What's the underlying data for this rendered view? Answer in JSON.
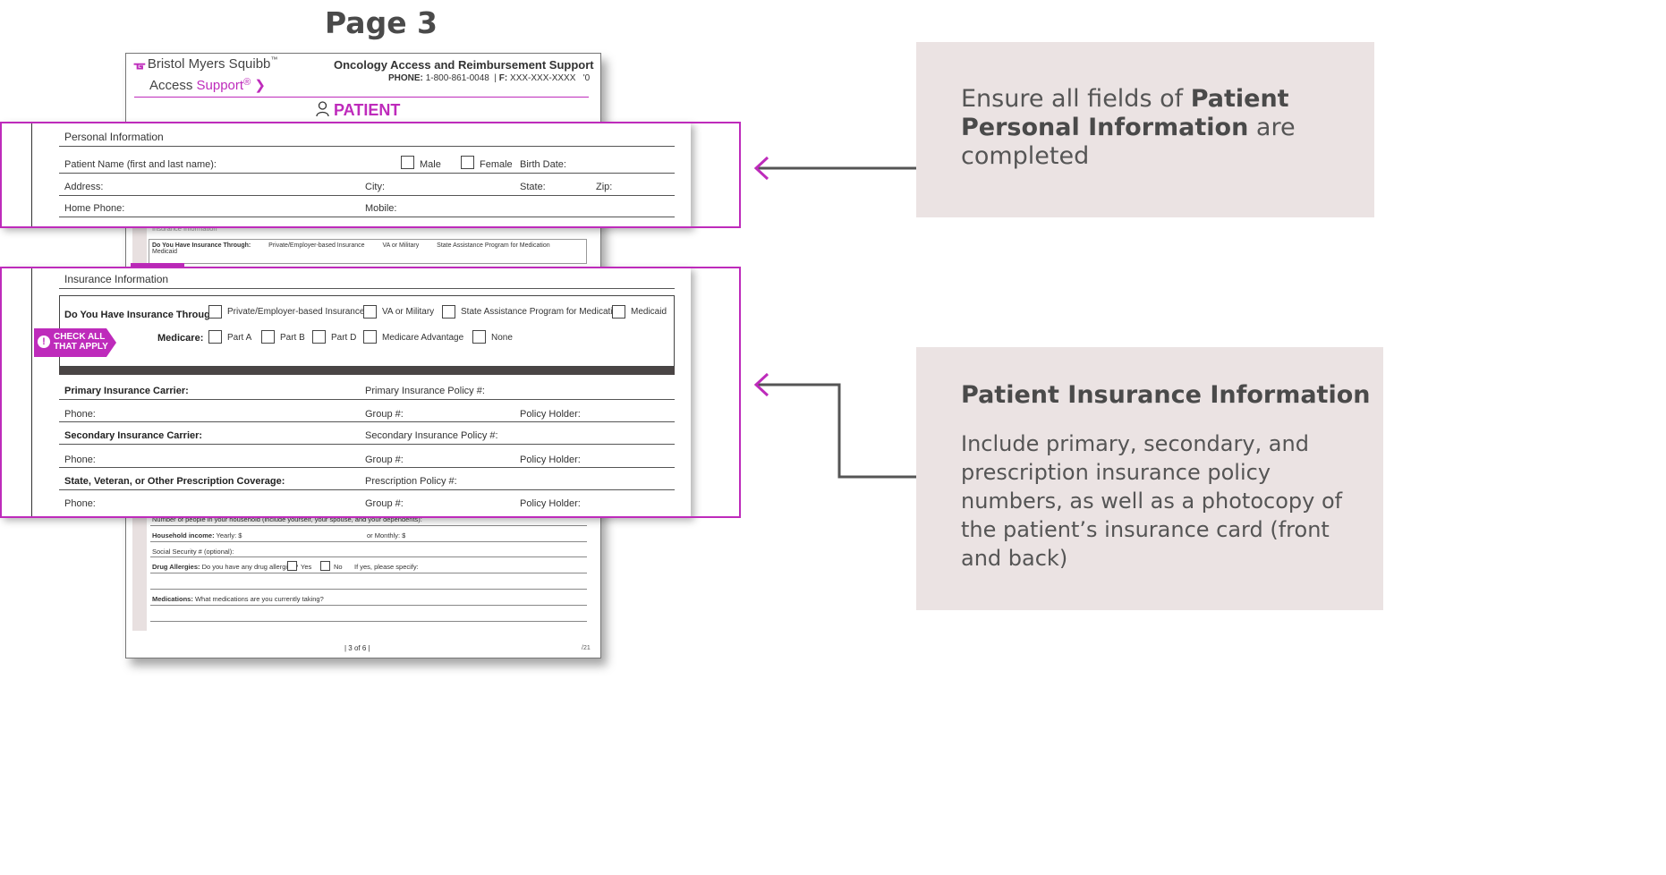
{
  "page_label": "Page 3",
  "form": {
    "brand": "Bristol Myers Squibb",
    "brand_mark": "™",
    "access_prefix": "Access ",
    "access_word": "Support",
    "program_title": "Oncology Access and Reimbursement Support",
    "phone_label": "PHONE:",
    "phone_value": "1-800-861-0048",
    "fax_label": "F:",
    "fax_value": "XXX-XXX-XXXX",
    "phone_tail": "'0",
    "section_title": "PATIENT",
    "page_number": "| 3 of 6 |",
    "revision": "/21",
    "bg_insurance_header": "Insurance Information",
    "bg_ins_label": "Do You Have Insurance Through:",
    "bg_ins_options": [
      "Private/Employer-based Insurance",
      "VA or Military",
      "State Assistance Program for Medication",
      "Medicaid"
    ],
    "bg_household_people": "Number of people in your household (include yourself, your spouse, and your dependents):",
    "bg_household_income": "Household income:",
    "bg_yearly": "Yearly: $",
    "bg_monthly": "or Monthly: $",
    "bg_ssn": "Social Security # (optional):",
    "bg_allergies": "Drug Allergies:",
    "bg_allergies_q": "Do you have any drug allergies?",
    "bg_yes": "Yes",
    "bg_no": "No",
    "bg_specify": "If yes, please specify:",
    "bg_medications": "Medications:",
    "bg_medications_q": "What medications are you currently taking?"
  },
  "personal": {
    "title": "Personal Information",
    "patient_name": "Patient Name (first and last name):",
    "male": "Male",
    "female": "Female",
    "birth_date": "Birth Date:",
    "address": "Address:",
    "city": "City:",
    "state": "State:",
    "zip": "Zip:",
    "home_phone": "Home Phone:",
    "mobile": "Mobile:"
  },
  "insurance": {
    "title": "Insurance Information",
    "through_label": "Do You Have Insurance Through:",
    "private": "Private/Employer-based Insurance",
    "va": "VA or Military",
    "state_program": "State Assistance Program for Medication",
    "medicaid": "Medicaid",
    "medicare_label": "Medicare:",
    "part_a": "Part A",
    "part_b": "Part B",
    "part_d": "Part D",
    "medicare_adv": "Medicare Advantage",
    "none": "None",
    "tag_line1": "CHECK ALL",
    "tag_line2": "THAT APPLY",
    "primary_carrier": "Primary Insurance Carrier:",
    "primary_policy": "Primary Insurance Policy #:",
    "phone": "Phone:",
    "group": "Group #:",
    "policy_holder": "Policy Holder:",
    "secondary_carrier": "Secondary Insurance Carrier:",
    "secondary_policy": "Secondary Insurance Policy #:",
    "state_coverage": "State, Veteran, or Other Prescription Coverage:",
    "prescription_policy": "Prescription Policy #:"
  },
  "callouts": {
    "c1_pre": "Ensure all fields of ",
    "c1_bold": "Patient Personal Information",
    "c1_post": " are completed",
    "c2_heading": "Patient Insurance Information",
    "c2_body": "Include primary, secondary, and prescription insurance policy numbers, as well as a photocopy of the patient’s insurance card (front and back)"
  },
  "colors": {
    "accent": "#be2bbb",
    "callout_bg": "#ebe3e3",
    "arrow": "#555555"
  }
}
